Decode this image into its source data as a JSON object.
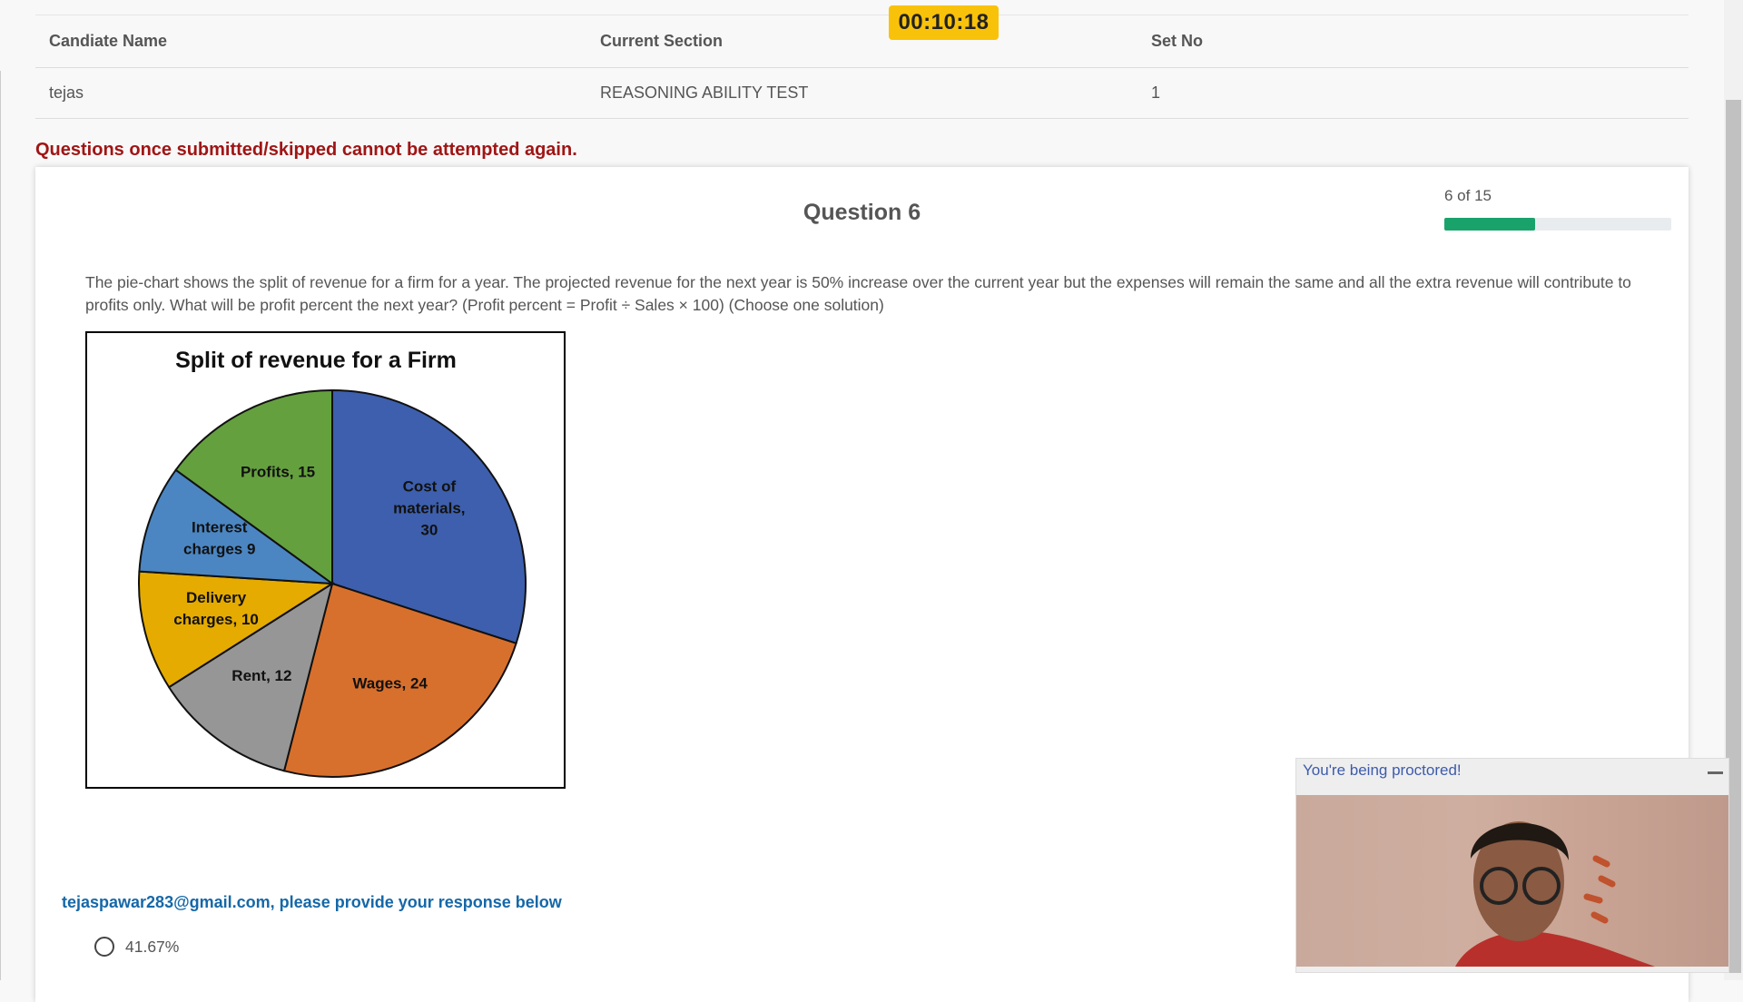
{
  "timer": "00:10:18",
  "header": {
    "columns": [
      "Candiate Name",
      "Current Section",
      "Set No"
    ],
    "values": [
      "tejas",
      "REASONING ABILITY TEST",
      "1"
    ]
  },
  "warning": "Questions once submitted/skipped cannot be attempted again.",
  "question": {
    "title": "Question 6",
    "progress_text": "6 of 15",
    "progress_fraction": 0.4,
    "text": "The pie-chart shows the split of revenue for a firm for a year. The projected revenue for the next year is 50% increase over the current year but the expenses will remain the same and all the extra revenue will contribute to profits only. What will be profit percent the next year? (Profit percent = Profit ÷ Sales × 100) (Choose one solution)"
  },
  "chart_data": {
    "type": "pie",
    "title": "Split of revenue for a Firm",
    "slices": [
      {
        "label": "Cost of materials, 30",
        "value": 30,
        "color": "#3d5fad"
      },
      {
        "label": "Wages, 24",
        "value": 24,
        "color": "#d8702d"
      },
      {
        "label": "Rent, 12",
        "value": 12,
        "color": "#969696"
      },
      {
        "label": "Delivery charges, 10",
        "value": 10,
        "color": "#e5ab00"
      },
      {
        "label": "Interest charges 9",
        "value": 9,
        "color": "#4b86c2"
      },
      {
        "label": "Profits, 15",
        "value": 15,
        "color": "#65a03f"
      }
    ]
  },
  "response": {
    "prompt": "tejaspawar283@gmail.com, please provide your response below",
    "options": [
      "41.67%"
    ]
  },
  "proctor": {
    "title": "You're being proctored!"
  },
  "colors": {
    "timer_bg": "#f9c20a",
    "warning": "#a01515",
    "progress": "#19a36b",
    "prompt": "#1568a8",
    "proctor_title": "#3d5bab"
  }
}
